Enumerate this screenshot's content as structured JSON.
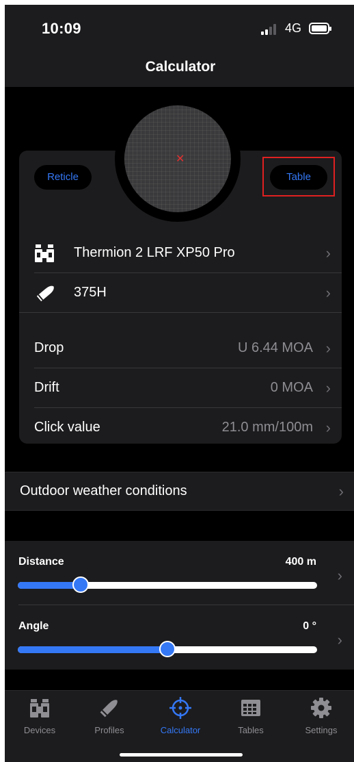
{
  "status_bar": {
    "time": "10:09",
    "network": "4G"
  },
  "header": {
    "title": "Calculator"
  },
  "scope": {
    "reticle_label": "Reticle",
    "table_label": "Table"
  },
  "device": {
    "name": "Thermion 2 LRF XP50 Pro",
    "icon": "binoculars-icon"
  },
  "profile": {
    "name": "375H",
    "icon": "bullet-icon"
  },
  "results": [
    {
      "label": "Drop",
      "value": "U 6.44 MOA"
    },
    {
      "label": "Drift",
      "value": "0 MOA"
    },
    {
      "label": "Click value",
      "value": "21.0 mm/100m"
    }
  ],
  "weather": {
    "label": "Outdoor weather conditions"
  },
  "distance": {
    "label": "Distance",
    "value": "400 m",
    "fraction": 0.21
  },
  "angle": {
    "label": "Angle",
    "value": "0 °",
    "fraction": 0.5
  },
  "tabs": [
    {
      "label": "Devices",
      "icon": "binoculars-icon",
      "active": false
    },
    {
      "label": "Profiles",
      "icon": "bullet-icon",
      "active": false
    },
    {
      "label": "Calculator",
      "icon": "crosshair-icon",
      "active": true
    },
    {
      "label": "Tables",
      "icon": "table-icon",
      "active": false
    },
    {
      "label": "Settings",
      "icon": "gear-icon",
      "active": false
    }
  ],
  "colors": {
    "accent": "#3478f6",
    "highlight": "#e02020",
    "background": "#000000",
    "card": "#1c1c1e"
  }
}
